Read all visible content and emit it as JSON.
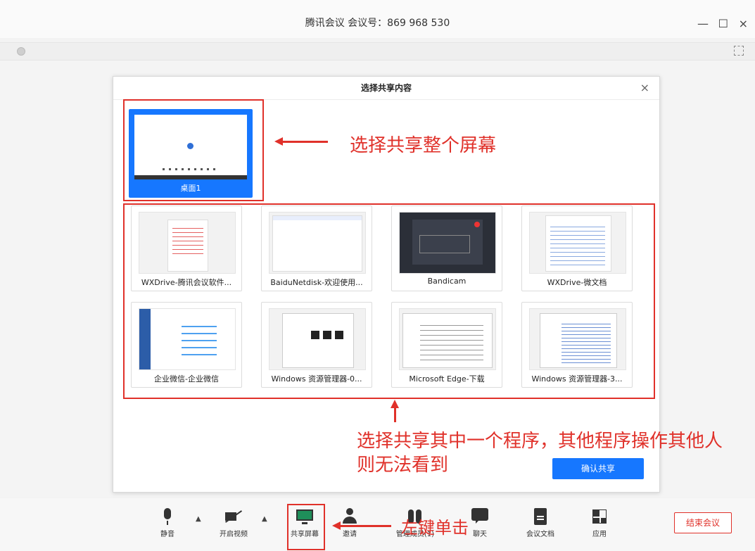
{
  "window": {
    "title": "腾讯会议 会议号：869 968 530",
    "minimize": "—",
    "maximize": "☐",
    "close": "×"
  },
  "dialog": {
    "title": "选择共享内容",
    "close": "×",
    "desktop_label": "桌面1",
    "apps": [
      {
        "label": "WXDrive-腾讯会议软件..."
      },
      {
        "label": "BaiduNetdisk-欢迎使用..."
      },
      {
        "label": "Bandicam"
      },
      {
        "label": "WXDrive-微文档"
      },
      {
        "label": "企业微信-企业微信"
      },
      {
        "label": "Windows 资源管理器-0..."
      },
      {
        "label": "Microsoft Edge-下载"
      },
      {
        "label": "Windows 资源管理器-3..."
      }
    ],
    "confirm_label": "确认共享"
  },
  "annotations": {
    "select_screen": "选择共享整个屏幕",
    "select_program_line1": "选择共享其中一个程序，其他程序操作其他人",
    "select_program_line2": "则无法看到",
    "left_click": "左键单击"
  },
  "toolbar": {
    "items": [
      {
        "label": "静音",
        "icon": "microphone-icon"
      },
      {
        "label": "开启视频",
        "icon": "camera-off-icon"
      },
      {
        "label": "共享屏幕",
        "icon": "share-screen-icon"
      },
      {
        "label": "邀请",
        "icon": "invite-icon"
      },
      {
        "label": "管理成员(1)",
        "icon": "members-icon"
      },
      {
        "label": "聊天",
        "icon": "chat-icon"
      },
      {
        "label": "会议文档",
        "icon": "document-icon"
      },
      {
        "label": "应用",
        "icon": "apps-icon"
      }
    ],
    "end_label": "结束会议"
  },
  "colors": {
    "accent": "#1677ff",
    "annotation": "#e0312a"
  }
}
